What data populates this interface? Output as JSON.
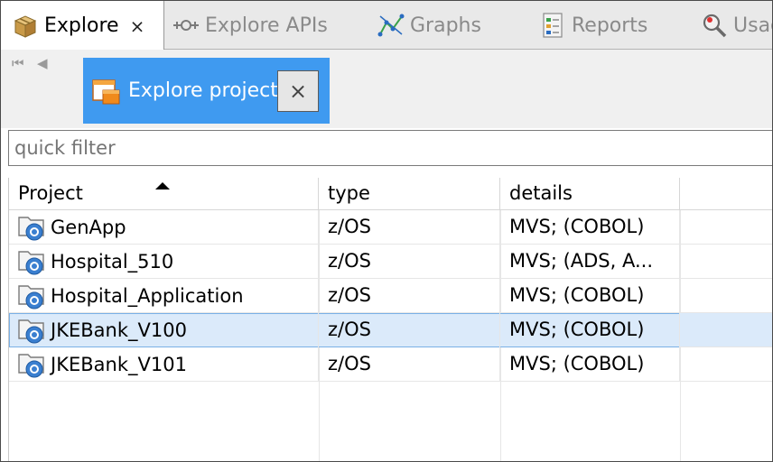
{
  "tabs": [
    {
      "label": "Explore",
      "icon": "package-icon",
      "active": true,
      "close": "⨯"
    },
    {
      "label": "Explore APIs",
      "icon": "api-icon",
      "active": false
    },
    {
      "label": "Graphs",
      "icon": "graph-icon",
      "active": false
    },
    {
      "label": "Reports",
      "icon": "report-icon",
      "active": false
    },
    {
      "label": "Usag",
      "icon": "usage-search-icon",
      "active": false
    }
  ],
  "view": {
    "nav_first": "⏮",
    "nav_prev": "◀",
    "subtab_label": "Explore projects",
    "subtab_close": "⨯"
  },
  "filter": {
    "placeholder": "quick filter",
    "value": ""
  },
  "table": {
    "columns": [
      "Project",
      "type",
      "details"
    ],
    "sort_column": "Project",
    "rows": [
      {
        "project": "GenApp",
        "type": "z/OS",
        "details": "MVS;  (COBOL)"
      },
      {
        "project": "Hospital_510",
        "type": "z/OS",
        "details": "MVS;  (ADS, A..."
      },
      {
        "project": "Hospital_Application",
        "type": "z/OS",
        "details": "MVS;  (COBOL)"
      },
      {
        "project": "JKEBank_V100",
        "type": "z/OS",
        "details": "MVS;  (COBOL)",
        "selected": true
      },
      {
        "project": "JKEBank_V101",
        "type": "z/OS",
        "details": "MVS;  (COBOL)"
      }
    ]
  },
  "colors": {
    "accent": "#3f9af0",
    "selection": "#dbeafa",
    "project_icon": "#3a7fd0"
  }
}
